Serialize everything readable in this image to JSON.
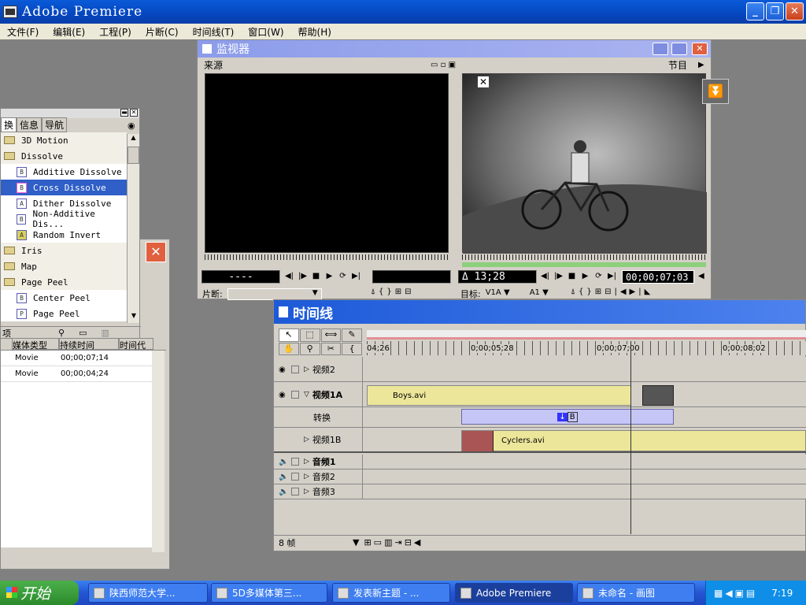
{
  "app": {
    "title": "Adobe Premiere"
  },
  "menu": [
    "文件(F)",
    "编辑(E)",
    "工程(P)",
    "片断(C)",
    "时间线(T)",
    "窗口(W)",
    "帮助(H)"
  ],
  "monitor": {
    "title": "监视器",
    "source_label": "来源",
    "program_label": "节目",
    "source_timecode": "----",
    "program_delta": "Δ 13;28",
    "program_timecode": "00;00;07;03",
    "clip_label": "片断:",
    "target_label": "目标:",
    "target_video": "V1A",
    "target_audio": "A1"
  },
  "transitions": {
    "tabs": [
      "换",
      "信息",
      "导航"
    ],
    "items": [
      {
        "label": "3D Motion",
        "kind": "folder"
      },
      {
        "label": "Dissolve",
        "kind": "folder"
      },
      {
        "label": "Additive Dissolve",
        "kind": "item"
      },
      {
        "label": "Cross Dissolve",
        "kind": "item",
        "selected": true
      },
      {
        "label": "Dither Dissolve",
        "kind": "item"
      },
      {
        "label": "Non-Additive Dis...",
        "kind": "item"
      },
      {
        "label": "Random Invert",
        "kind": "item"
      },
      {
        "label": "Iris",
        "kind": "folder"
      },
      {
        "label": "Map",
        "kind": "folder"
      },
      {
        "label": "Page Peel",
        "kind": "folder"
      },
      {
        "label": "Center Peel",
        "kind": "item"
      },
      {
        "label": "Page Peel",
        "kind": "item"
      }
    ],
    "footer_label": "项"
  },
  "project": {
    "columns": [
      "媒体类型",
      "持续时间",
      "时间代"
    ],
    "rows": [
      {
        "type": "Movie",
        "duration": "00;00;07;14"
      },
      {
        "type": "Movie",
        "duration": "00;00;04;24"
      }
    ]
  },
  "timeline": {
    "title": "时间线",
    "ruler": [
      "04;26",
      "0;00;05;28",
      "0;00;07;00",
      "0;00;08;02"
    ],
    "tracks": {
      "v2": "视频2",
      "v1a": "视频1A",
      "trans": "转换",
      "v1b": "视频1B",
      "a1": "音频1",
      "a2": "音频2",
      "a3": "音频3"
    },
    "clips": {
      "boys": "Boys.avi",
      "cyclers": "Cyclers.avi"
    },
    "zoom": "8 帧"
  },
  "taskbar": {
    "start": "开始",
    "tasks": [
      "陕西师范大学...",
      "5D多媒体第三...",
      "发表新主题 - ...",
      "Adobe Premiere",
      "未命名 - 画图"
    ],
    "clock": "7:19"
  }
}
